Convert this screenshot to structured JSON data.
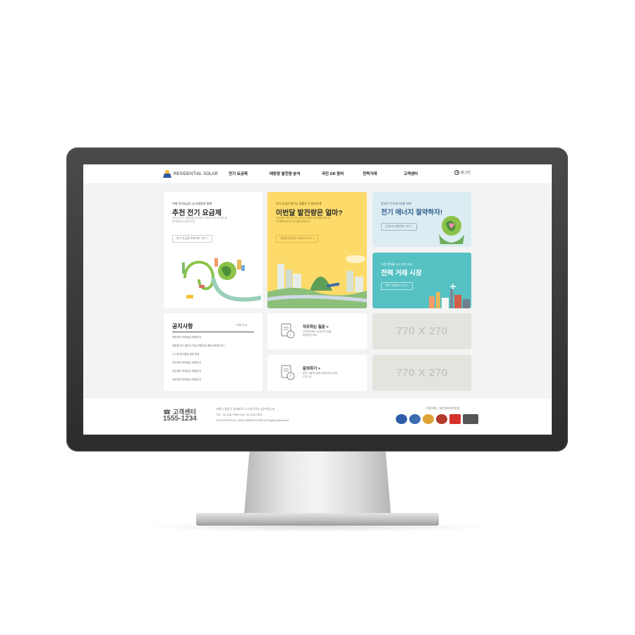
{
  "header": {
    "logo_text": "RESIDENTIAL SOLAR",
    "nav": [
      "전기 요금제",
      "태양광 발전량 분석",
      "국민 DR 참여",
      "전력거래",
      "고객센터"
    ],
    "login": "로그인"
  },
  "card_plan": {
    "kicker": "이제 전기요금도 내 사용량과 함께",
    "title": "추천 전기 요금제",
    "desc1": "우리집 전기 사용량을 분석하고 어떤건 비교 분석을 통",
    "desc2": "해 최적의 요금제 추천",
    "button": "전기 요금제 조회하러 가기"
  },
  "card_generation": {
    "kicker": "전기 요금은 줄이고 생활은 더 편리하게",
    "title": "이번달 발전량은 얼마?",
    "desc1": "우리집과 우리 단지의 설치된 태양광 발전량을 확인하",
    "desc2": "고 예측하여 전기요금을 절감하자!",
    "button": "태양광 발전량 조회하러 가기"
  },
  "card_save": {
    "kicker": "탈피한 전기에너지를 판매",
    "title": "전기 에너지 절약하자!",
    "button": "국민DR 참여하러 가기"
  },
  "card_trade": {
    "kicker": "이젠 전력을 사고 파는시대",
    "title": "전력 거래 시장",
    "button": "전력 거래하러 가기"
  },
  "notice": {
    "title": "공지사항",
    "more": "더보기",
    "items": [
      "개인정보 처리방침 개정안내",
      "태양광 미니 발전소 보급 지원대상 확대 태양광 미니 ...",
      "시스템 점기점검 일정 변경",
      "개인정보 처리방침 개정안내",
      "개인정보 처리방침 개정안내",
      "개인정보 처리방침 개정안내"
    ]
  },
  "faq": {
    "title": "자주하는 질문",
    "desc1": "고객센터에서 궁금하신 점을",
    "desc2": "말씀해 주세요."
  },
  "inquiry": {
    "title": "문의하기",
    "desc1": "문의 내용에 대해 친절하게 안내해",
    "desc2": "드립니다."
  },
  "banners": [
    "770 X 270",
    "770 X 270"
  ],
  "footer": {
    "cs_title": "고객센터",
    "cs_phone": "1555-1234",
    "address": "서울시 성동구 성내부로 173 한국주소 (성수동1가)",
    "contact": "TEL. 02-418-7550  FAX. 02-418-7551",
    "copyright": "COPYRIGHT(C) 2015 OMNISYSTEM All Rights Reserved.",
    "links": "이용약관  |  개인정보처리방침",
    "badges": [
      "#2e5ea8",
      "#3b6cb0",
      "#e0a33a",
      "#b43a2b",
      "#d6322b",
      "#555555"
    ]
  },
  "colors": {
    "yellow_card": "#fddb6a",
    "light_blue_card": "#dcecf3",
    "teal_card": "#55c1c3",
    "accent_green": "#8bc34a"
  }
}
